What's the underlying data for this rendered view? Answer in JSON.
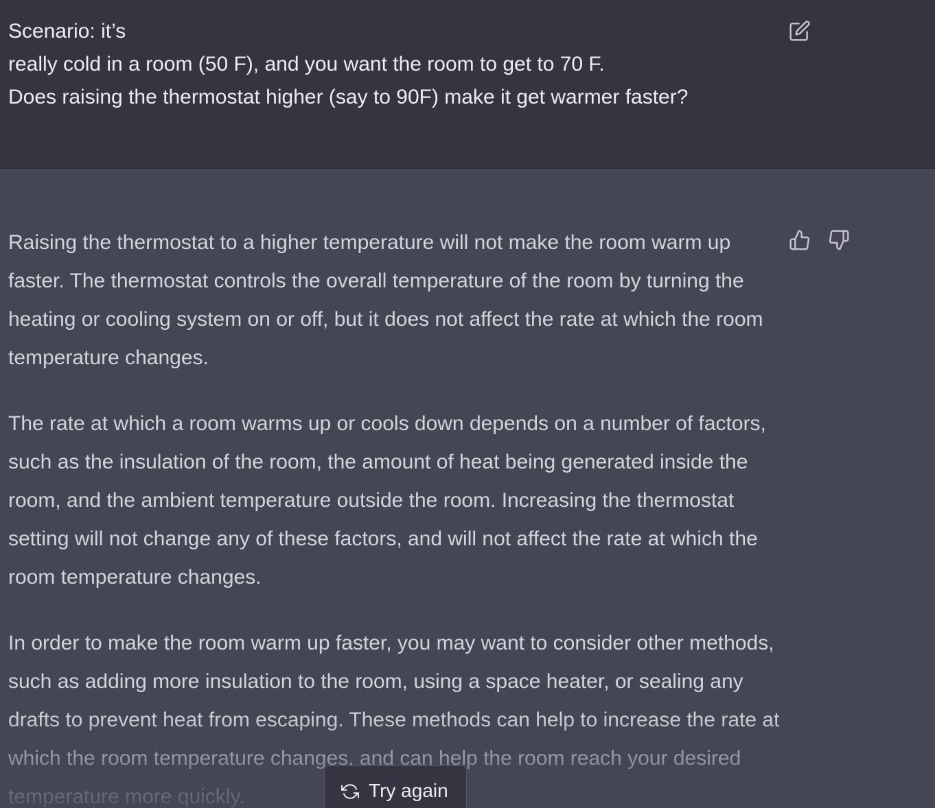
{
  "user_message": {
    "lines": [
      "Scenario: it’s",
      "really cold in a room (50 F), and you want the room to get to 70 F.",
      "Does raising the thermostat higher (say to 90F) make it get warmer faster?"
    ]
  },
  "assistant_message": {
    "paragraphs": [
      "Raising the thermostat to a higher temperature will not make the room warm up faster. The thermostat controls the overall temperature of the room by turning the heating or cooling system on or off, but it does not affect the rate at which the room temperature changes.",
      "The rate at which a room warms up or cools down depends on a number of factors, such as the insulation of the room, the amount of heat being generated inside the room, and the ambient temperature outside the room. Increasing the thermostat setting will not change any of these factors, and will not affect the rate at which the room temperature changes.",
      "In order to make the room warm up faster, you may want to consider other methods, such as adding more insulation to the room, using a space heater, or sealing any drafts to prevent heat from escaping. These methods can help to increase the rate at which the room temperature changes, and can help the room reach your desired temperature more quickly."
    ]
  },
  "actions": {
    "try_again_label": "Try again"
  },
  "icons": {
    "edit": "edit-icon",
    "thumbs_up": "thumbs-up-icon",
    "thumbs_down": "thumbs-down-icon",
    "refresh": "refresh-icon"
  },
  "colors": {
    "user_bg": "#343541",
    "assistant_bg": "#444654",
    "user_text": "#ececf1",
    "assistant_text": "#d1d5db"
  }
}
